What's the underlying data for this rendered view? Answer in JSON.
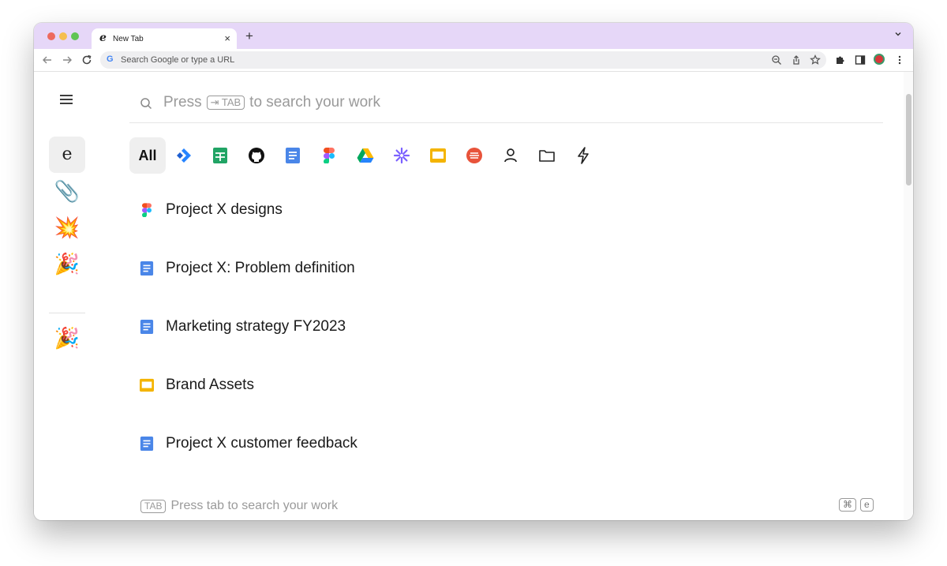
{
  "browser": {
    "tab_title": "New Tab",
    "tab_favicon": "e",
    "new_tab_label": "+",
    "tab_close_label": "×",
    "omnibox_placeholder": "Search Google or type a URL"
  },
  "sidebar": {
    "active_item": "e",
    "items": [
      {
        "emoji": "📎",
        "icon": "paperclip-icon"
      },
      {
        "emoji": "💥",
        "icon": "collision-icon"
      },
      {
        "emoji": "🎉",
        "icon": "party-popper-icon"
      }
    ],
    "bottom_items": [
      {
        "emoji": "🎉",
        "icon": "party-popper-icon"
      }
    ]
  },
  "search": {
    "prefix": "Press",
    "key": "⇥ TAB",
    "suffix": "to search your work"
  },
  "filters": {
    "all_label": "All",
    "items": [
      "jira-icon",
      "sheets-icon",
      "github-icon",
      "docs-icon",
      "figma-icon",
      "drive-icon",
      "asana-icon",
      "slides-icon",
      "chat-icon",
      "person-icon",
      "folder-icon",
      "bolt-icon"
    ]
  },
  "results": [
    {
      "label": "Project X designs",
      "icon": "figma-icon"
    },
    {
      "label": "Project X: Problem definition",
      "icon": "docs-icon"
    },
    {
      "label": "Marketing strategy FY2023",
      "icon": "docs-icon"
    },
    {
      "label": "Brand Assets",
      "icon": "slides-icon"
    },
    {
      "label": "Project X customer feedback",
      "icon": "docs-icon"
    }
  ],
  "footer": {
    "key": "TAB",
    "hint": "Press tab to search your work",
    "shortcut_keys": [
      "⌘",
      "e"
    ]
  },
  "colors": {
    "tab_bar": "#e6d7f8",
    "docs_blue": "#4a86e8",
    "sheets_green": "#21a465",
    "slides_yellow": "#f4b400"
  }
}
